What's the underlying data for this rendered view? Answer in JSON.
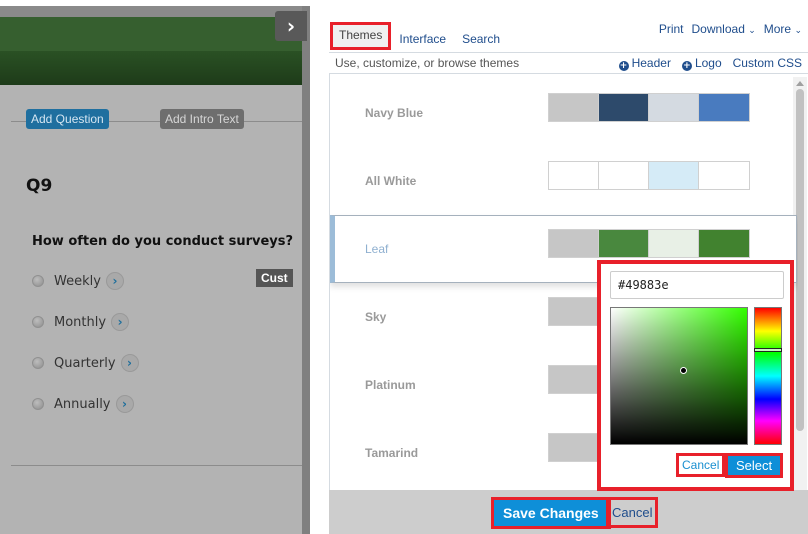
{
  "survey": {
    "collapse_icon": "chevron-right",
    "add_question_label": "Add Question",
    "add_intro_label": "Add Intro Text",
    "question_number": "Q9",
    "question_text": "How often do you conduct surveys?",
    "options": [
      {
        "label": "Weekly"
      },
      {
        "label": "Monthly"
      },
      {
        "label": "Quarterly"
      },
      {
        "label": "Annually"
      }
    ],
    "option_arrow_glyph": "›",
    "collapse_glyph": "›",
    "banner_color": "#365f2f"
  },
  "editor": {
    "tabs": [
      {
        "label": "Themes",
        "active": true
      },
      {
        "label": "Interface",
        "active": false
      },
      {
        "label": "Search",
        "active": false
      }
    ],
    "top_links": {
      "print": "Print",
      "download": "Download",
      "more": "More",
      "caret": "⌄"
    },
    "description": "Use, customize, or browse themes",
    "sub_links": {
      "header": "Header",
      "logo": "Logo",
      "custom_css": "Custom CSS",
      "plus_glyph": "+"
    },
    "themes": [
      {
        "name": "Navy Blue",
        "colors": [
          "#c6c6c6",
          "#2d4a6b",
          "#d4dae1",
          "#497bbf"
        ]
      },
      {
        "name": "All White",
        "colors": [
          "#ffffff",
          "#ffffff",
          "#d5ebf7",
          "#ffffff"
        ]
      },
      {
        "name": "Leaf",
        "colors": [
          "#c6c6c6",
          "#49883e",
          "#e8f0e6",
          "#41822f"
        ],
        "selected": true
      },
      {
        "name": "Sky",
        "colors": [
          "#c6c6c6"
        ]
      },
      {
        "name": "Platinum",
        "colors": [
          "#c6c6c6"
        ]
      },
      {
        "name": "Tamarind",
        "colors": [
          "#c6c6c6"
        ]
      }
    ],
    "tooltip_text": "Cust",
    "save_label": "Save Changes",
    "cancel_label": "Cancel"
  },
  "color_picker": {
    "hex_value": "#49883e",
    "cancel_label": "Cancel",
    "select_label": "Select"
  },
  "colors": {
    "accent_blue": "#0e8fd8",
    "link_blue": "#1f4d8c",
    "highlight_red": "#e8202a"
  }
}
